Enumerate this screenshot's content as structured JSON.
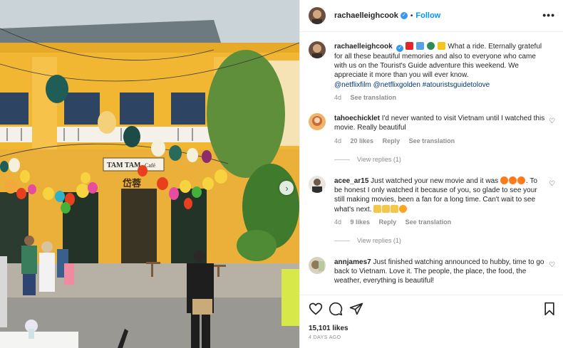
{
  "post": {
    "username": "rachaelleighcook",
    "verified_badge": "✓",
    "dot": "•",
    "follow_label": "Follow",
    "more_label": "•••"
  },
  "caption": {
    "username": "rachaelleighcook",
    "text": "What a ride. Eternally grateful for all these beautiful memories and also to everyone who came with us on the Tourist's Guide adventure this weekend. We appreciate it more than you will ever know.",
    "tags": "@netflixfilm @netflixgolden #atouristsguidetolove",
    "time": "4d",
    "see_translation": "See translation",
    "emoji_icons": [
      "heart-icon",
      "airplane-icon",
      "globe-icon",
      "sparkles-icon"
    ]
  },
  "comments": [
    {
      "username": "tahoechicklet",
      "text": "I'd never wanted to visit Vietnam until I watched this movie. Really beautiful",
      "time": "4d",
      "likes": "20 likes",
      "reply": "Reply",
      "see_translation": "See translation",
      "view_replies": "View replies (1)"
    },
    {
      "username": "acee_ar15",
      "text_a": "Just watched your new movie and it was",
      "text_b": ". To be honest I only watched it because of you, so glade to see your still making movies, been a fan for a long time. Can't wait to see what's next.",
      "time": "4d",
      "likes": "9 likes",
      "reply": "Reply",
      "see_translation": "See translation",
      "view_replies": "View replies (1)"
    },
    {
      "username": "annjames7",
      "text": "Just finished watching announced to hubby, time to go back to Vietnam. Love it. The people, the place, the food, the weather, everything is beautiful!"
    }
  ],
  "footer": {
    "likes": "15,101 likes",
    "ago": "4 DAYS AGO"
  },
  "photo": {
    "shop_sign": "TAM TAM",
    "shop_sign_small": "Café",
    "shop_sign_cn": "岱蓉"
  },
  "colors": {
    "accent": "#0095f6",
    "verified": "#3897f0",
    "hashtag": "#00376b",
    "muted": "#8e8e8e",
    "wall_yellow": "#f2b633"
  },
  "icons": {
    "heart": "heart-icon",
    "comment": "comment-icon",
    "share": "share-icon",
    "save": "bookmark-icon",
    "next": "chevron-right-icon"
  }
}
